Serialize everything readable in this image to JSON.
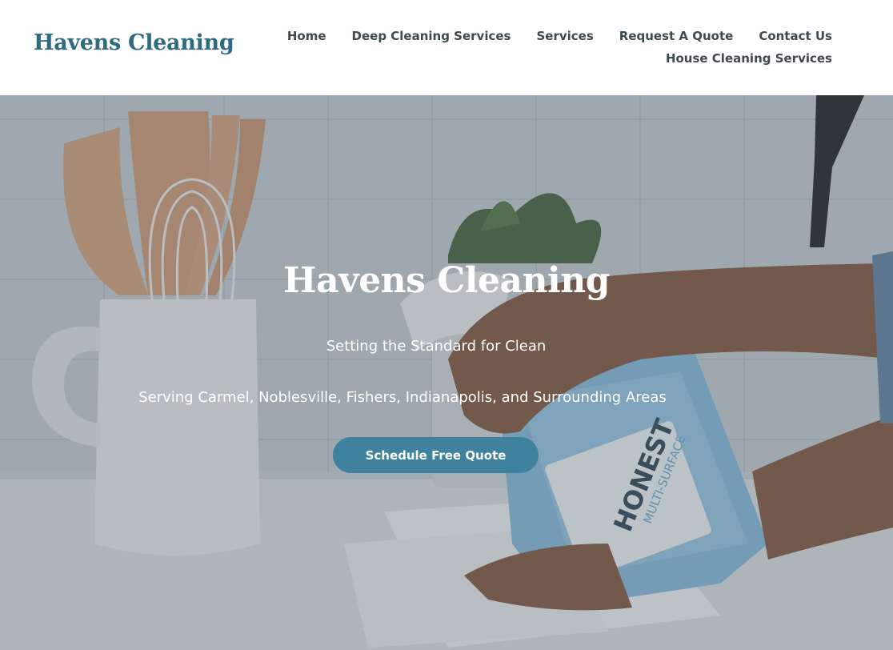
{
  "header": {
    "logo": "Havens Cleaning",
    "nav": {
      "home": "Home",
      "deep_cleaning": "Deep Cleaning Services",
      "services": "Services",
      "request_quote": "Request A Quote",
      "contact": "Contact Us",
      "house_cleaning": "House Cleaning Services"
    }
  },
  "hero": {
    "title": "Havens Cleaning",
    "tagline": "Setting the Standard for Clean",
    "areas": "Serving Carmel, Noblesville, Fishers, Indianapolis, and Surrounding Areas",
    "cta_label": "Schedule Free Quote",
    "bottle_brand": "HONEST",
    "bottle_product": "MULTI-SURFACE"
  },
  "colors": {
    "brand": "#2e6a80",
    "cta": "#3f82a0",
    "nav_text": "#3e4a50"
  }
}
